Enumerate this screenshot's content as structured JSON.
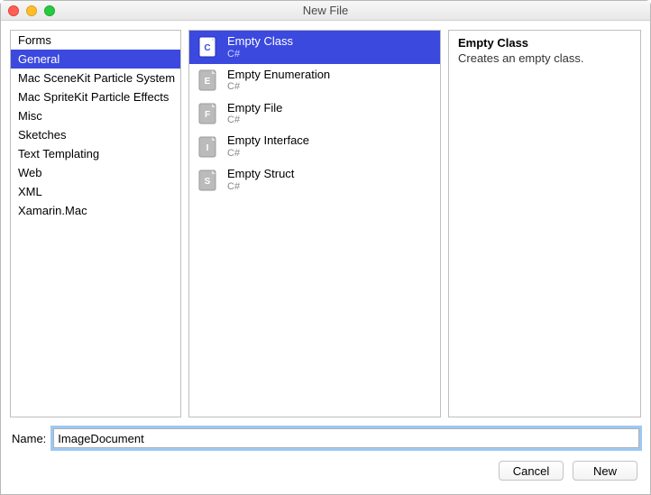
{
  "window": {
    "title": "New File"
  },
  "categories": [
    {
      "label": "Forms"
    },
    {
      "label": "General",
      "selected": true
    },
    {
      "label": "Mac SceneKit Particle System"
    },
    {
      "label": "Mac SpriteKit Particle Effects"
    },
    {
      "label": "Misc"
    },
    {
      "label": "Sketches"
    },
    {
      "label": "Text Templating"
    },
    {
      "label": "Web"
    },
    {
      "label": "XML"
    },
    {
      "label": "Xamarin.Mac"
    }
  ],
  "templates": [
    {
      "title": "Empty Class",
      "sub": "C#",
      "icon": "C",
      "selected": true
    },
    {
      "title": "Empty Enumeration",
      "sub": "C#",
      "icon": "E"
    },
    {
      "title": "Empty File",
      "sub": "C#",
      "icon": "F"
    },
    {
      "title": "Empty Interface",
      "sub": "C#",
      "icon": "I"
    },
    {
      "title": "Empty Struct",
      "sub": "C#",
      "icon": "S"
    }
  ],
  "description": {
    "title": "Empty Class",
    "text": "Creates an empty class."
  },
  "name": {
    "label": "Name:",
    "value": "ImageDocument"
  },
  "buttons": {
    "cancel": "Cancel",
    "new": "New"
  }
}
